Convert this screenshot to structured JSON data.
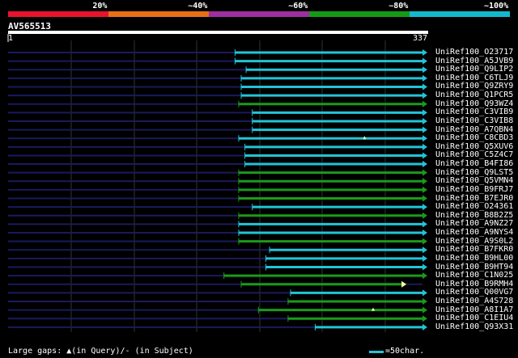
{
  "legend": [
    {
      "label": "20%",
      "color": "#e8132d"
    },
    {
      "label": "~40%",
      "color": "#e86f17"
    },
    {
      "label": "~60%",
      "color": "#9d2f9f"
    },
    {
      "label": "~80%",
      "color": "#169a16"
    },
    {
      "label": "~100%",
      "color": "#14b8cc"
    }
  ],
  "query": {
    "id": "AV565513",
    "start_label": "1",
    "end_label": "337",
    "length": 337
  },
  "colors": {
    "background": "#000000",
    "query_line": "#1a1a5e",
    "grid": "#2a3a2a",
    "cyan_hit": "#22c4d8",
    "green_hit": "#1b9a1b",
    "gap_marker": "#ffffa0"
  },
  "chart_data": {
    "type": "alignment",
    "hits": [
      {
        "name": "UniRef100_O23717",
        "start": 185,
        "end": 337,
        "color": "cyan"
      },
      {
        "name": "UniRef100_A5JVB9",
        "start": 185,
        "end": 337,
        "color": "cyan"
      },
      {
        "name": "UniRef100_Q9LIP2",
        "start": 194,
        "end": 337,
        "color": "cyan"
      },
      {
        "name": "UniRef100_C6TLJ9",
        "start": 190,
        "end": 337,
        "color": "cyan"
      },
      {
        "name": "UniRef100_Q9ZRY9",
        "start": 190,
        "end": 337,
        "color": "cyan"
      },
      {
        "name": "UniRef100_Q1PCR5",
        "start": 190,
        "end": 337,
        "color": "cyan"
      },
      {
        "name": "UniRef100_Q93WZ4",
        "start": 188,
        "end": 337,
        "color": "green"
      },
      {
        "name": "UniRef100_C3VIB9",
        "start": 199,
        "end": 337,
        "color": "cyan"
      },
      {
        "name": "UniRef100_C3VIB8",
        "start": 199,
        "end": 337,
        "color": "cyan"
      },
      {
        "name": "UniRef100_A7QBN4",
        "start": 199,
        "end": 337,
        "color": "cyan"
      },
      {
        "name": "UniRef100_C8CBD3",
        "start": 188,
        "end": 337,
        "color": "cyan",
        "gap": 290
      },
      {
        "name": "UniRef100_Q5XUV6",
        "start": 193,
        "end": 337,
        "color": "cyan"
      },
      {
        "name": "UniRef100_C5Z4C7",
        "start": 193,
        "end": 337,
        "color": "cyan"
      },
      {
        "name": "UniRef100_B4FI86",
        "start": 193,
        "end": 337,
        "color": "cyan"
      },
      {
        "name": "UniRef100_Q9LST5",
        "start": 188,
        "end": 337,
        "color": "green"
      },
      {
        "name": "UniRef100_Q5VMN4",
        "start": 188,
        "end": 337,
        "color": "green"
      },
      {
        "name": "UniRef100_B9FRJ7",
        "start": 188,
        "end": 337,
        "color": "green"
      },
      {
        "name": "UniRef100_B7EJR0",
        "start": 188,
        "end": 337,
        "color": "green"
      },
      {
        "name": "UniRef100_O24361",
        "start": 199,
        "end": 337,
        "color": "cyan"
      },
      {
        "name": "UniRef100_B8B2Z5",
        "start": 188,
        "end": 337,
        "color": "green"
      },
      {
        "name": "UniRef100_A9NZ27",
        "start": 188,
        "end": 337,
        "color": "cyan"
      },
      {
        "name": "UniRef100_A9NYS4",
        "start": 188,
        "end": 337,
        "color": "cyan"
      },
      {
        "name": "UniRef100_A9S0L2",
        "start": 188,
        "end": 337,
        "color": "green"
      },
      {
        "name": "UniRef100_B7FKR0",
        "start": 213,
        "end": 337,
        "color": "cyan"
      },
      {
        "name": "UniRef100_B9HL00",
        "start": 210,
        "end": 337,
        "color": "cyan"
      },
      {
        "name": "UniRef100_B9HT94",
        "start": 210,
        "end": 337,
        "color": "cyan"
      },
      {
        "name": "UniRef100_C1N025",
        "start": 176,
        "end": 337,
        "color": "green"
      },
      {
        "name": "UniRef100_B9RMH4",
        "start": 190,
        "end": 320,
        "color": "green",
        "end_arrow_color": "yellow"
      },
      {
        "name": "UniRef100_Q00VG7",
        "start": 230,
        "end": 337,
        "color": "cyan"
      },
      {
        "name": "UniRef100_A4S728",
        "start": 228,
        "end": 337,
        "color": "green"
      },
      {
        "name": "UniRef100_A8I1A7",
        "start": 204,
        "end": 337,
        "color": "green",
        "gap": 297
      },
      {
        "name": "UniRef100_C1EIU4",
        "start": 228,
        "end": 337,
        "color": "green"
      },
      {
        "name": "UniRef100_Q93X31",
        "start": 250,
        "end": 337,
        "color": "cyan"
      }
    ]
  },
  "footer": {
    "left": "Large gaps: ▲(in Query)/- (in Subject)",
    "right": "=50char."
  }
}
